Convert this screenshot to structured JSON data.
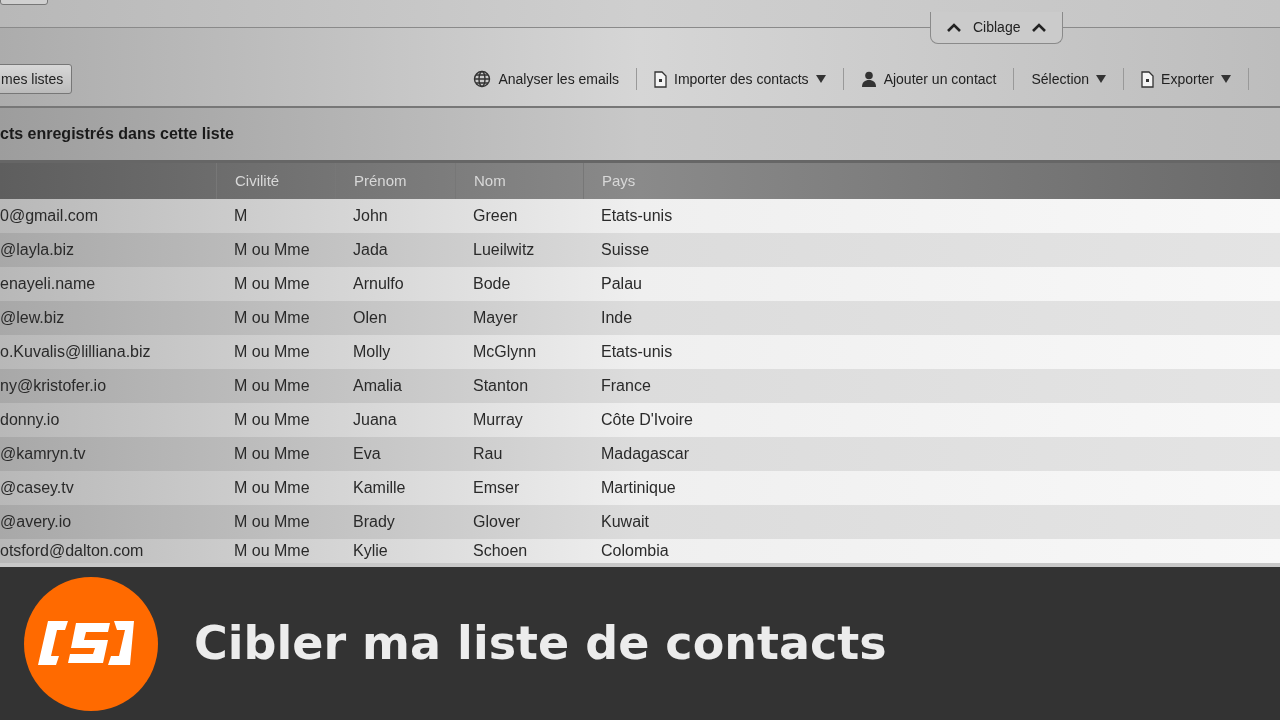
{
  "panel_tab": {
    "label": "Ciblage"
  },
  "toolbar": {
    "left_button": "mes listes",
    "items": [
      {
        "label": "Analyser les emails",
        "menu": false
      },
      {
        "label": "Importer des contacts",
        "menu": true
      },
      {
        "label": "Ajouter un contact",
        "menu": false
      },
      {
        "label": "Sélection",
        "menu": true
      },
      {
        "label": "Exporter",
        "menu": true
      }
    ]
  },
  "list_heading": "cts enregistrés dans cette liste",
  "table": {
    "columns": [
      "",
      "Civilité",
      "Prénom",
      "Nom",
      "Pays"
    ],
    "rows": [
      [
        "0@gmail.com",
        "M",
        "John",
        "Green",
        "Etats-unis"
      ],
      [
        "@layla.biz",
        "M ou Mme",
        "Jada",
        "Lueilwitz",
        "Suisse"
      ],
      [
        "enayeli.name",
        "M ou Mme",
        "Arnulfo",
        "Bode",
        "Palau"
      ],
      [
        "@lew.biz",
        "M ou Mme",
        "Olen",
        "Mayer",
        "Inde"
      ],
      [
        "o.Kuvalis@lilliana.biz",
        "M ou Mme",
        "Molly",
        "McGlynn",
        "Etats-unis"
      ],
      [
        "ny@kristofer.io",
        "M ou Mme",
        "Amalia",
        "Stanton",
        "France"
      ],
      [
        "donny.io",
        "M ou Mme",
        "Juana",
        "Murray",
        "Côte D'Ivoire"
      ],
      [
        "@kamryn.tv",
        "M ou Mme",
        "Eva",
        "Rau",
        "Madagascar"
      ],
      [
        "@casey.tv",
        "M ou Mme",
        "Kamille",
        "Emser",
        "Martinique"
      ],
      [
        "@avery.io",
        "M ou Mme",
        "Brady",
        "Glover",
        "Kuwait"
      ],
      [
        "otsford@dalton.com",
        "M ou Mme",
        "Kylie",
        "Schoen",
        "Colombia"
      ]
    ]
  },
  "banner": {
    "title": "Cibler ma liste de contacts"
  }
}
